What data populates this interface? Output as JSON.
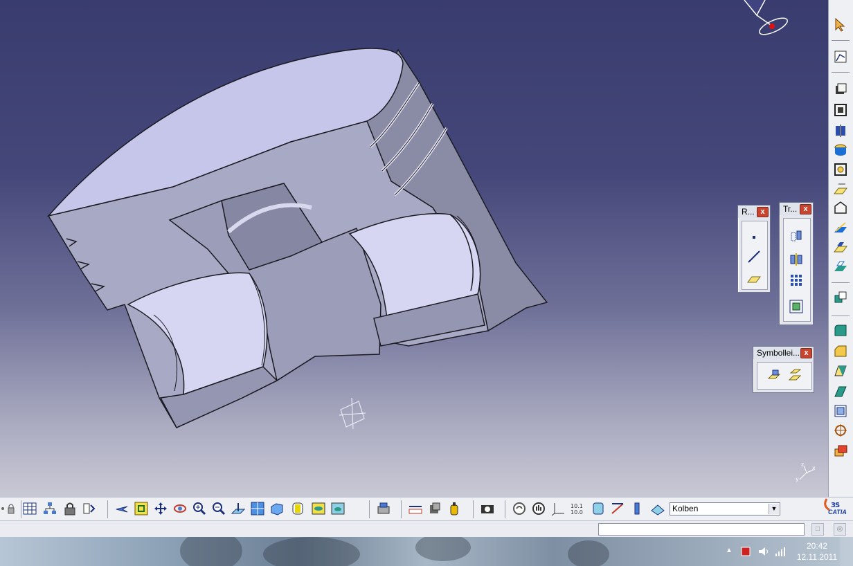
{
  "viewport": {
    "background_top": "#393c6e",
    "background_bottom": "#c9c9d5",
    "model_face_color": "#c5c6e6",
    "model_side_color": "#8f90a8"
  },
  "floating_toolbars": [
    {
      "title": "R...",
      "buttons": [
        "point-icon",
        "line-icon",
        "plane-icon"
      ]
    },
    {
      "title": "Tr...",
      "buttons": [
        "translate-icon",
        "symmetry-icon",
        "pattern-icon",
        "scale-icon"
      ]
    },
    {
      "title": "Symbollei...",
      "buttons": [
        "sketch-based-icon",
        "sketch-plane-icon"
      ]
    }
  ],
  "right_toolbar": {
    "items": [
      "select-arrow-icon",
      "sketcher-icon",
      "pad-icon",
      "pocket-icon",
      "shaft-icon",
      "hole-icon",
      "rib-icon",
      "groove-icon",
      "stiffener-icon",
      "multi-pad-icon",
      "draft-icon",
      "shell-icon",
      "axis-system-icon",
      "fillet-icon",
      "chamfer-icon",
      "thickness-icon",
      "split-icon",
      "body-icon",
      "anchor-icon",
      "boolean-icon"
    ]
  },
  "bottom_toolbar": {
    "current_part": "Kolben",
    "items": [
      "dot-icon",
      "lock-icon",
      "table-icon",
      "tree-icon",
      "padlock-icon",
      "update-icon",
      "fly-icon",
      "fit-all-icon",
      "pan-icon",
      "rotate-icon",
      "zoom-in-icon",
      "zoom-out-icon",
      "normal-view-icon",
      "multi-view-icon",
      "iso-view-icon",
      "render-style-icon",
      "hide-show-icon",
      "swap-visible-icon",
      "apply-material-icon",
      "measure-icon",
      "measure-item-icon",
      "measure-inertia-icon",
      "capture-icon",
      "knowledge-icon",
      "formula-icon",
      "axis-icon",
      "units-icon",
      "sketch-analysis-icon",
      "constraint-icon",
      "layer-icon",
      "work-object-icon"
    ]
  },
  "logo": {
    "text": "CATIA",
    "brand_color": "#e05a1e",
    "text_color": "#1c3c9c"
  },
  "command_bar": {
    "input_value": "",
    "placeholder": ""
  },
  "taskbar": {
    "time": "20:42",
    "date": "12.11.2011",
    "tray_icons": [
      "show-hidden-icon",
      "power-icon",
      "volume-icon",
      "network-icon"
    ]
  }
}
